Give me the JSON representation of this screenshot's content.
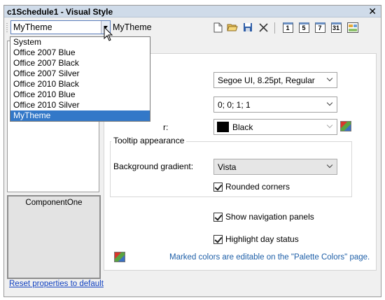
{
  "window": {
    "title": "c1Schedule1 - Visual Style",
    "close_glyph": "✕"
  },
  "toolbar": {
    "theme_value": "MyTheme",
    "theme_name_text": "MyTheme",
    "icons": [
      "new-document-icon",
      "open-folder-icon",
      "save-icon",
      "delete-icon",
      "day-view-icon",
      "work-week-view-icon",
      "week-view-icon",
      "month-view-icon",
      "timeline-view-icon"
    ],
    "view_labels": [
      "1",
      "5",
      "7",
      "31"
    ]
  },
  "dropdown": {
    "items": [
      "System",
      "Office 2007 Blue",
      "Office 2007 Black",
      "Office 2007 Silver",
      "Office 2010 Black",
      "Office 2010 Blue",
      "Office 2010 Silver",
      "MyTheme"
    ],
    "selected": "MyTheme"
  },
  "preview": {
    "bottom_label": "ComponentOne"
  },
  "props": {
    "font_value": "Segoe UI, 8.25pt, Regular",
    "padding_value": "0; 0; 1; 1",
    "color_label_partial": "r:",
    "color_value": "Black",
    "tooltip_group_title": "Tooltip appearance",
    "bg_gradient_label": "Background gradient:",
    "bg_gradient_value": "Vista",
    "rounded_corners": "Rounded corners",
    "show_nav_panels": "Show navigation panels",
    "highlight_day_status": "Highlight day status",
    "palette_note": "Marked colors are editable on the \"Palette Colors\" page."
  },
  "footer": {
    "reset_link": "Reset properties to default"
  },
  "colors": {
    "titlebar": "#cfdbe9",
    "selection": "#3378c8",
    "link": "#1040c0",
    "note": "#1e5fa8"
  }
}
